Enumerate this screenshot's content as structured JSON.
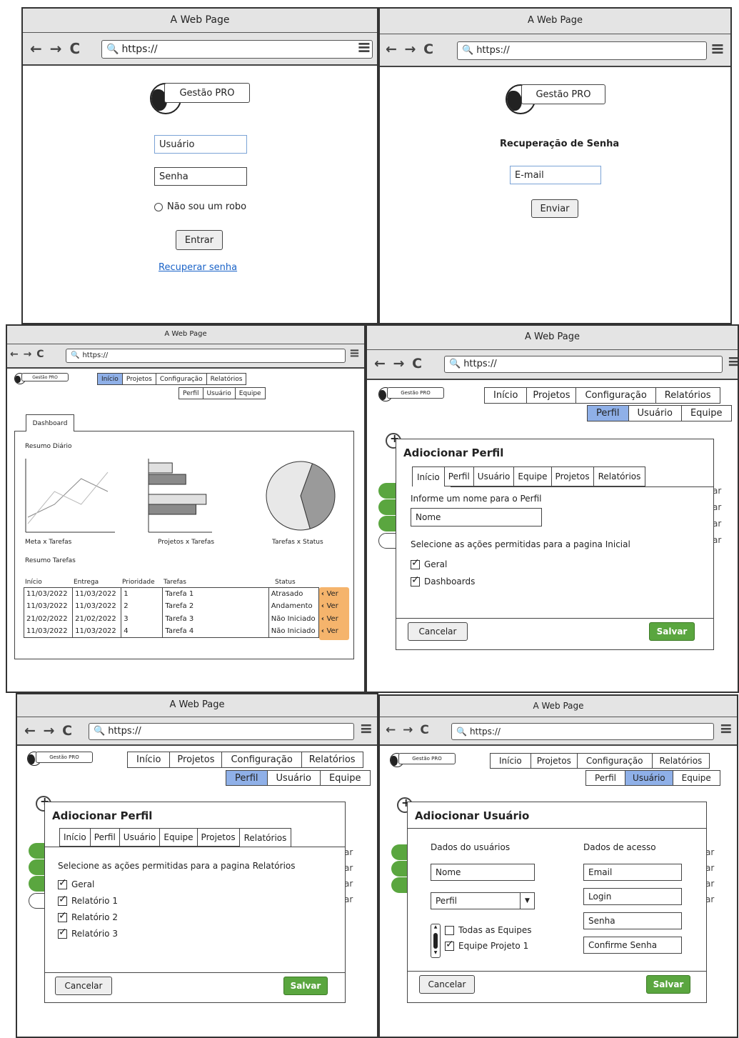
{
  "common": {
    "window_title": "A Web Page",
    "url": "https://",
    "nav_back": "←",
    "nav_forward": "→",
    "nav_reload": "C",
    "menu_icon": "≡",
    "logo_text": "Gestão PRO",
    "top_tabs": [
      "Início",
      "Projetos",
      "Configuração",
      "Relatórios"
    ],
    "sub_tabs": [
      "Perfil",
      "Usuário",
      "Equipe"
    ]
  },
  "login": {
    "username_placeholder": "Usuário",
    "password_placeholder": "Senha",
    "captcha_label": "Não sou um robo",
    "submit": "Entrar",
    "recover_link": "Recuperar senha"
  },
  "recover": {
    "heading": "Recuperação de Senha",
    "email_placeholder": "E-mail",
    "submit": "Enviar"
  },
  "dashboard": {
    "tab": "Dashboard",
    "daily_summary": "Resumo Diário",
    "chart_labels": [
      "Meta x Tarefas",
      "Projetos x Tarefas",
      "Tarefas x Status"
    ],
    "tasks_summary": "Resumo Tarefas",
    "table_headers": [
      "Início",
      "Entrega",
      "Prioridade",
      "Tarefas",
      "Status"
    ],
    "rows": [
      {
        "inicio": "11/03/2022",
        "entrega": "11/03/2022",
        "prioridade": "1",
        "tarefa": "Tarefa 1",
        "status": "Atrasado",
        "action": "Ver"
      },
      {
        "inicio": "11/03/2022",
        "entrega": "11/03/2022",
        "prioridade": "2",
        "tarefa": "Tarefa 2",
        "status": "Andamento",
        "action": "Ver"
      },
      {
        "inicio": "21/02/2022",
        "entrega": "21/02/2022",
        "prioridade": "3",
        "tarefa": "Tarefa 3",
        "status": "Não Iniciado",
        "action": "Ver"
      },
      {
        "inicio": "11/03/2022",
        "entrega": "11/03/2022",
        "prioridade": "4",
        "tarefa": "Tarefa 4",
        "status": "Não Iniciado",
        "action": "Ver"
      }
    ],
    "chart_data": [
      {
        "type": "line",
        "title": "",
        "xlabel": "Meta x Tarefas",
        "ylabel": "",
        "series": [
          {
            "values": [
              0.2,
              0.4,
              0.8,
              0.6
            ]
          },
          {
            "values": [
              0.1,
              0.6,
              0.4,
              0.9
            ]
          }
        ]
      },
      {
        "type": "bar",
        "orientation": "horizontal",
        "xlabel": "Projetos x Tarefas",
        "values": [
          0.35,
          0.55,
          0.85,
          0.7
        ]
      },
      {
        "type": "pie",
        "xlabel": "Tarefas x Status",
        "values": [
          40,
          60
        ],
        "colors": [
          "#9a9a9a",
          "#e8e8e8"
        ]
      }
    ]
  },
  "profile_inicio": {
    "title": "Adiocionar Perfil",
    "tabs": [
      "Início",
      "Perfil",
      "Usuário",
      "Equipe",
      "Projetos",
      "Relatórios"
    ],
    "name_prompt": "Informe um nome para o Perfil",
    "name_placeholder": "Nome",
    "actions_prompt": "Selecione as ações permitidas para a pagina Inicial",
    "checks": [
      "Geral",
      "Dashboards"
    ],
    "cancel": "Cancelar",
    "save": "Salvar"
  },
  "profile_relatorios": {
    "title": "Adiocionar Perfil",
    "tabs": [
      "Início",
      "Perfil",
      "Usuário",
      "Equipe",
      "Projetos",
      "Relatórios"
    ],
    "actions_prompt": "Selecione as ações permitidas para a pagina Relatórios",
    "checks": [
      "Geral",
      "Relatório 1",
      "Relatório 2",
      "Relatório 3"
    ],
    "cancel": "Cancelar",
    "save": "Salvar"
  },
  "user_add": {
    "title": "Adiocionar Usuário",
    "user_data": "Dados do usuários",
    "access_data": "Dados de acesso",
    "name_placeholder": "Nome",
    "profile_select": "Perfil",
    "team_all": "Todas as Equipes",
    "team_one": "Equipe Projeto 1",
    "email_placeholder": "Email",
    "login_placeholder": "Login",
    "password_placeholder": "Senha",
    "confirm_placeholder": "Confirme Senha",
    "cancel": "Cancelar",
    "save": "Salvar"
  },
  "background_fragments": {
    "plus_icon": "+",
    "row_suffix": "ar"
  }
}
